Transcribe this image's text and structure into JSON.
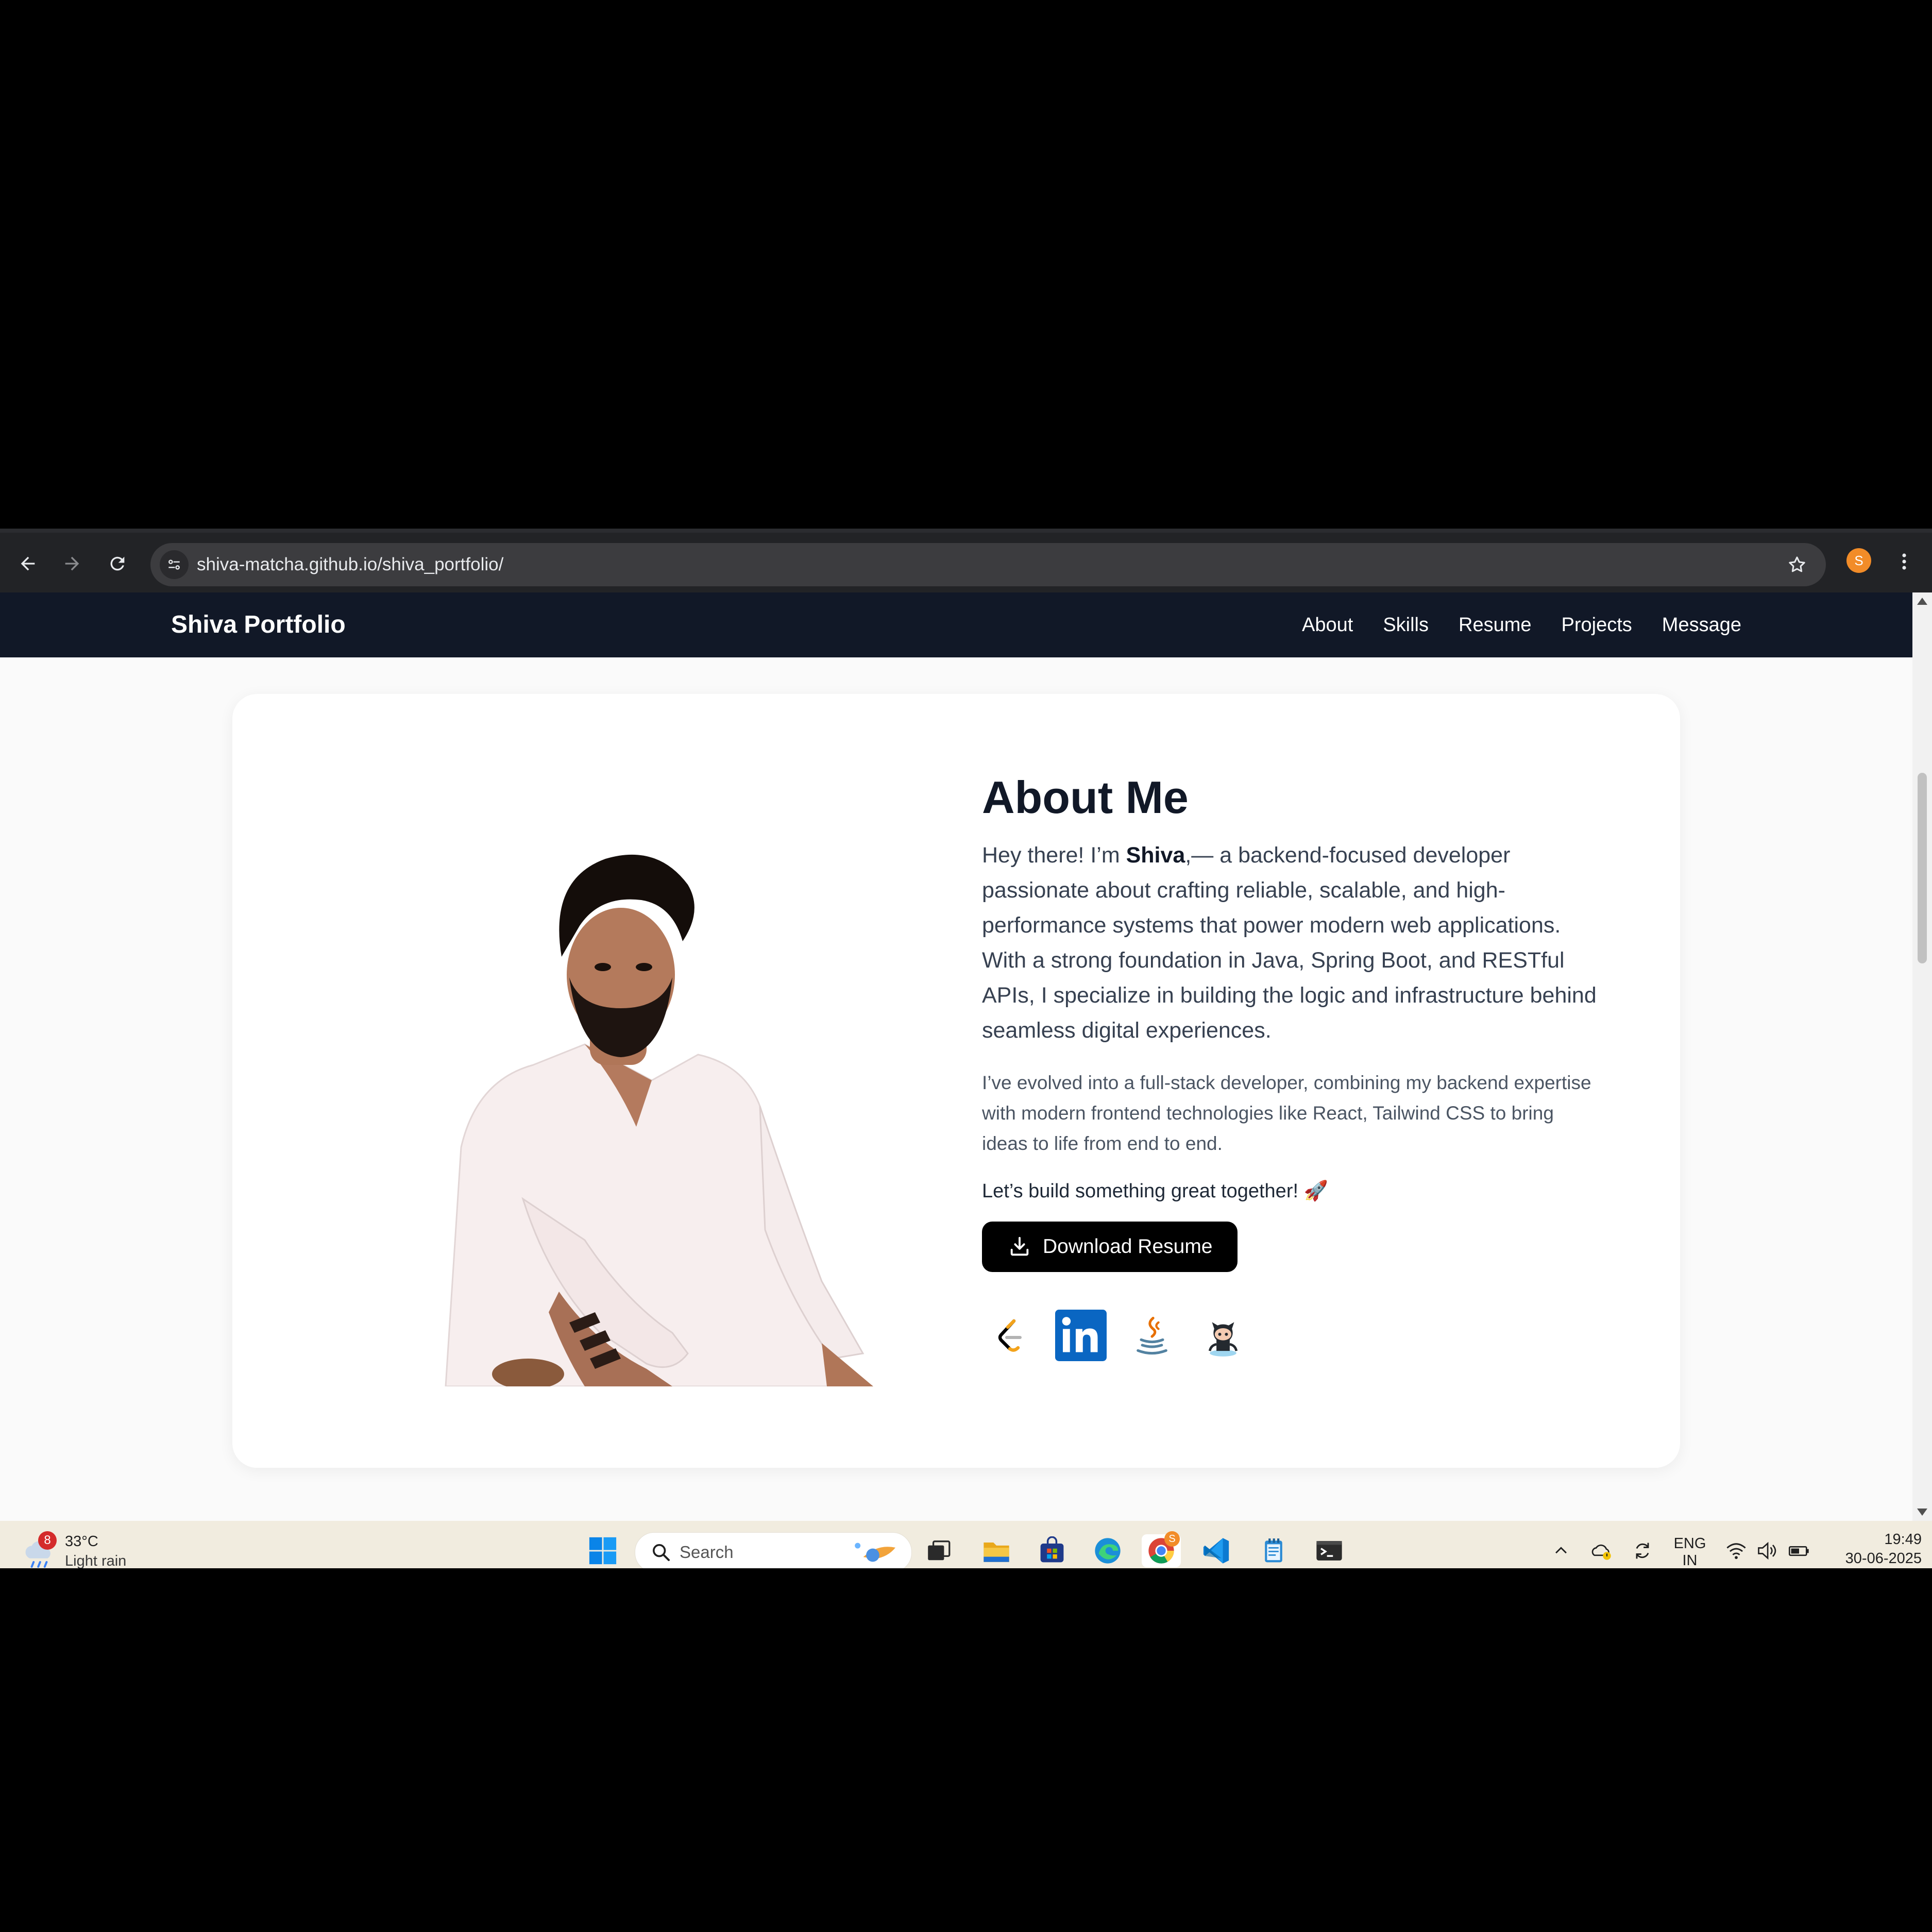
{
  "browser": {
    "url": "shiva-matcha.github.io/shiva_portfolio/",
    "profile_initial": "S"
  },
  "site": {
    "brand": "Shiva Portfolio",
    "nav": [
      "About",
      "Skills",
      "Resume",
      "Projects",
      "Message"
    ]
  },
  "about": {
    "title": "About Me",
    "p1_before": "Hey there! I’m ",
    "p1_name": "Shiva",
    "p1_after": ",— a backend-focused developer passionate about crafting reliable, scalable, and high-performance systems that power modern web applications. With a strong foundation in Java, Spring Boot, and RESTful APIs, I specialize in building the logic and infrastructure behind seamless digital experiences.",
    "p2": "I’ve evolved into a full-stack developer, combining my backend expertise with modern frontend technologies like React, Tailwind CSS to bring ideas to life from end to end.",
    "p3": "Let’s build something great together! 🚀",
    "download_label": "Download Resume",
    "social_icons": [
      "leetcode-icon",
      "linkedin-icon",
      "java-icon",
      "github-icon"
    ]
  },
  "taskbar": {
    "weather_temp": "33°C",
    "weather_desc": "Light rain",
    "weather_badge": "8",
    "search_label": "Search",
    "chrome_badge": "S",
    "lang_top": "ENG",
    "lang_bottom": "IN",
    "time": "19:49",
    "date": "30-06-2025"
  },
  "colors": {
    "header_bg": "#111827",
    "browser_bg": "#222326",
    "button_bg": "#000000",
    "linkedin": "#0a66c2",
    "taskbar_bg": "#f1ecdf"
  }
}
